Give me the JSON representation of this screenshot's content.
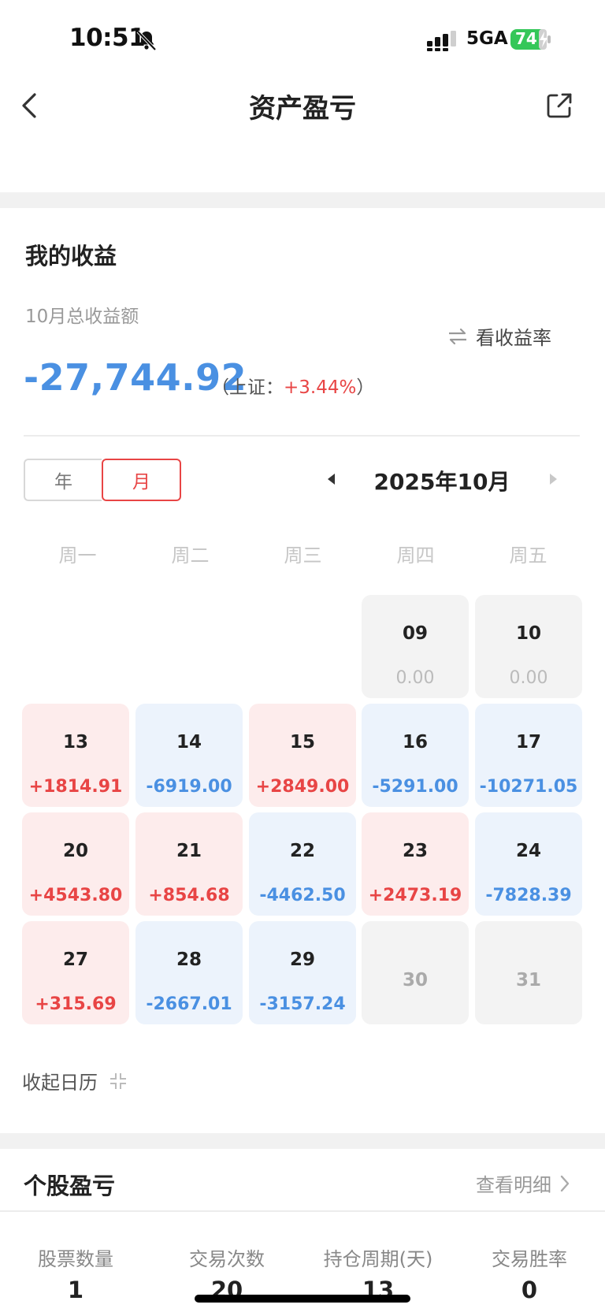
{
  "status_bar": {
    "time": "10:51",
    "network": "5GA",
    "battery": "74"
  },
  "nav": {
    "title": "资产盈亏"
  },
  "earnings": {
    "section_title": "我的收益",
    "month_total_label": "10月总收益额",
    "switch_label": "看收益率",
    "total_value": "-27,744.92",
    "index_prefix": "（上证：",
    "index_pct": "+3.44%",
    "index_suffix": "）"
  },
  "calendar": {
    "toggle_year": "年",
    "toggle_month": "月",
    "selected_toggle": "月",
    "month_label": "2025年10月",
    "weekdays": [
      "周一",
      "周二",
      "周三",
      "周四",
      "周五"
    ],
    "days": [
      {
        "day": "09",
        "value": "0.00",
        "status": "zero"
      },
      {
        "day": "10",
        "value": "0.00",
        "status": "zero"
      },
      {
        "day": "13",
        "value": "+1814.91",
        "status": "pos"
      },
      {
        "day": "14",
        "value": "-6919.00",
        "status": "neg"
      },
      {
        "day": "15",
        "value": "+2849.00",
        "status": "pos"
      },
      {
        "day": "16",
        "value": "-5291.00",
        "status": "neg"
      },
      {
        "day": "17",
        "value": "-10271.05",
        "status": "neg"
      },
      {
        "day": "20",
        "value": "+4543.80",
        "status": "pos"
      },
      {
        "day": "21",
        "value": "+854.68",
        "status": "pos"
      },
      {
        "day": "22",
        "value": "-4462.50",
        "status": "neg"
      },
      {
        "day": "23",
        "value": "+2473.19",
        "status": "pos"
      },
      {
        "day": "24",
        "value": "-7828.39",
        "status": "neg"
      },
      {
        "day": "27",
        "value": "+315.69",
        "status": "pos"
      },
      {
        "day": "28",
        "value": "-2667.01",
        "status": "neg"
      },
      {
        "day": "29",
        "value": "-3157.24",
        "status": "neg"
      },
      {
        "day": "30",
        "value": "",
        "status": "future"
      },
      {
        "day": "31",
        "value": "",
        "status": "future"
      }
    ],
    "collapse_label": "收起日历"
  },
  "stocks": {
    "section_title": "个股盈亏",
    "detail_label": "查看明细",
    "stats": [
      {
        "label": "股票数量",
        "value": "1"
      },
      {
        "label": "交易次数",
        "value": "20"
      },
      {
        "label": "持仓周期(天)",
        "value": "13"
      },
      {
        "label": "交易胜率",
        "value": "0"
      }
    ]
  },
  "colors": {
    "gain": "#e84545",
    "loss": "#4a90e2",
    "gain_bg": "#fdecec",
    "loss_bg": "#ecf3fc",
    "neutral_bg": "#f3f3f3",
    "battery": "#34c759"
  }
}
